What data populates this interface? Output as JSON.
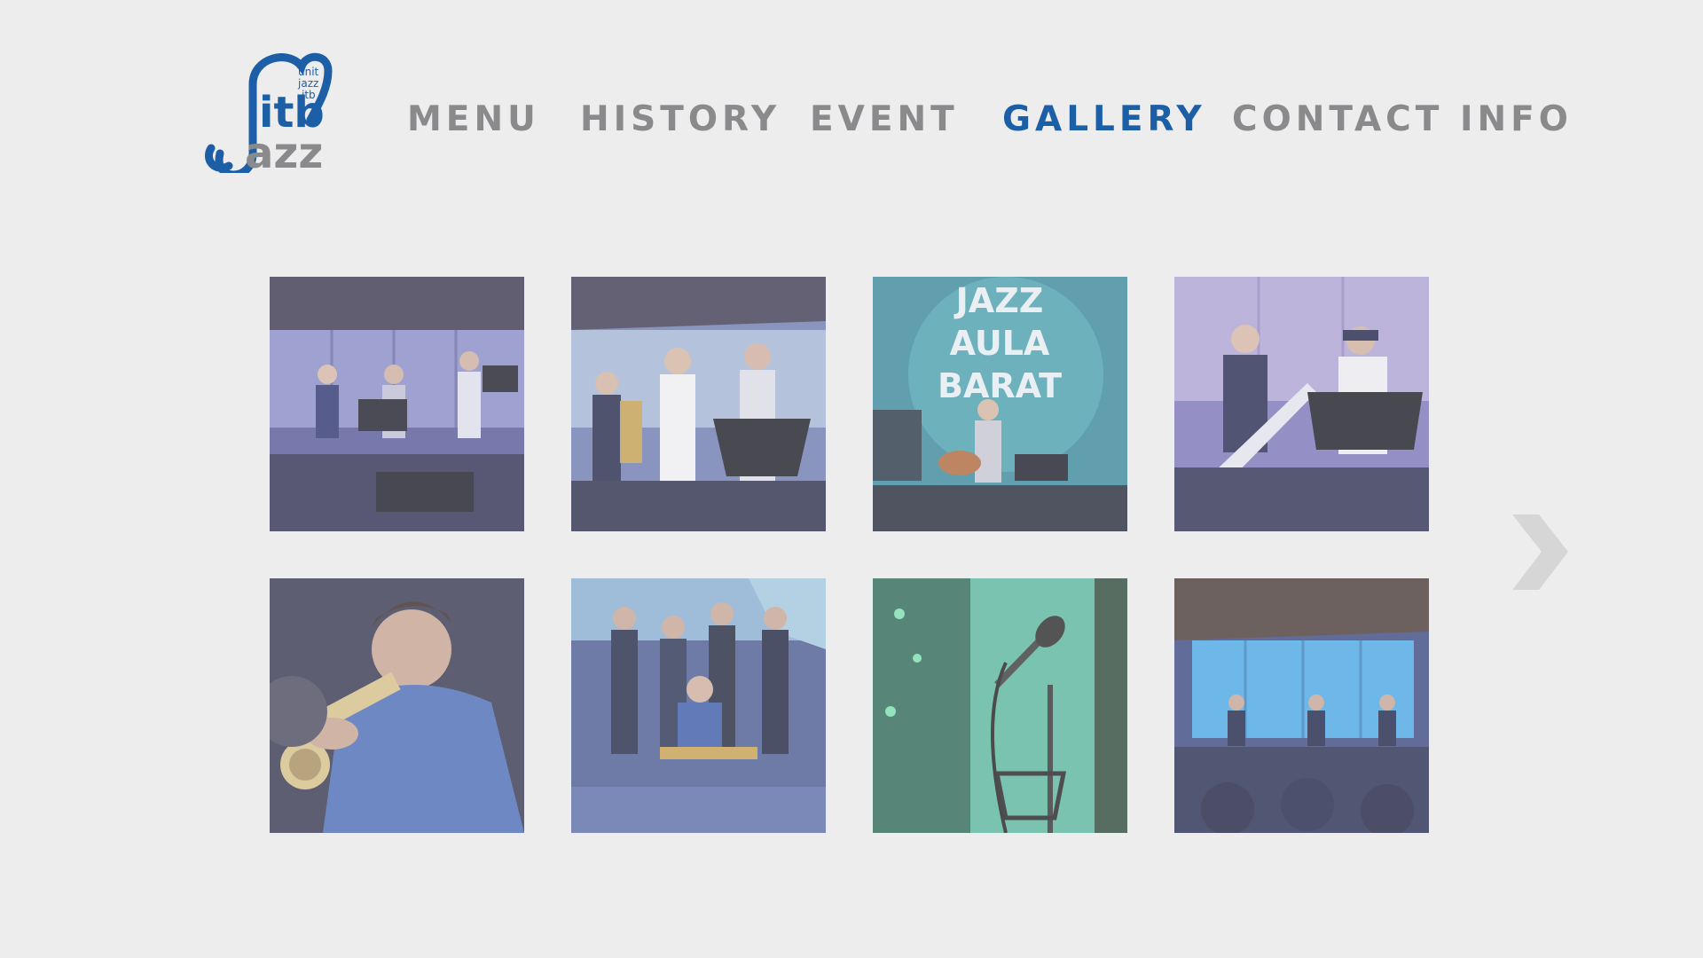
{
  "logo": {
    "name": "itb jazz",
    "text_main_top": "itb",
    "text_main_bottom": "azz",
    "text_small": [
      "unit",
      "jazz",
      "itb"
    ],
    "color": "#1d5fa6"
  },
  "nav": {
    "items": [
      {
        "label": "MENU"
      },
      {
        "label": "HISTORY"
      },
      {
        "label": "EVENT"
      },
      {
        "label": "GALLERY",
        "active": true
      },
      {
        "label": "CONTACT INFO"
      }
    ],
    "text_color": "#8a8a8c",
    "active_color": "#1d5fa6"
  },
  "gallery": {
    "photos": [
      {
        "subject": "band on wooden stage with guitars and saxophone",
        "tint": "#5a5aa0"
      },
      {
        "subject": "saxophone players with music stands",
        "tint": "#6a7cae"
      },
      {
        "subject": "guitarist under Jazz Aula Barat banner",
        "tint": "#3f8a9a",
        "banner_text": [
          "JAZZ",
          "AULA",
          "BARAT"
        ]
      },
      {
        "subject": "bass guitarist and capped player",
        "tint": "#7a74b8"
      },
      {
        "subject": "trumpet player in blue shirt",
        "tint": "#3a3a58"
      },
      {
        "subject": "group photo of band members with instruments",
        "tint": "#4a5c92"
      },
      {
        "subject": "microphone on stand with green curtain",
        "tint": "#4aa890"
      },
      {
        "subject": "band playing in hall with blue windows",
        "tint": "#3a5cb0"
      }
    ]
  },
  "controls": {
    "next_icon": "chevron-right-icon",
    "next_color": "#d6d6d6"
  }
}
